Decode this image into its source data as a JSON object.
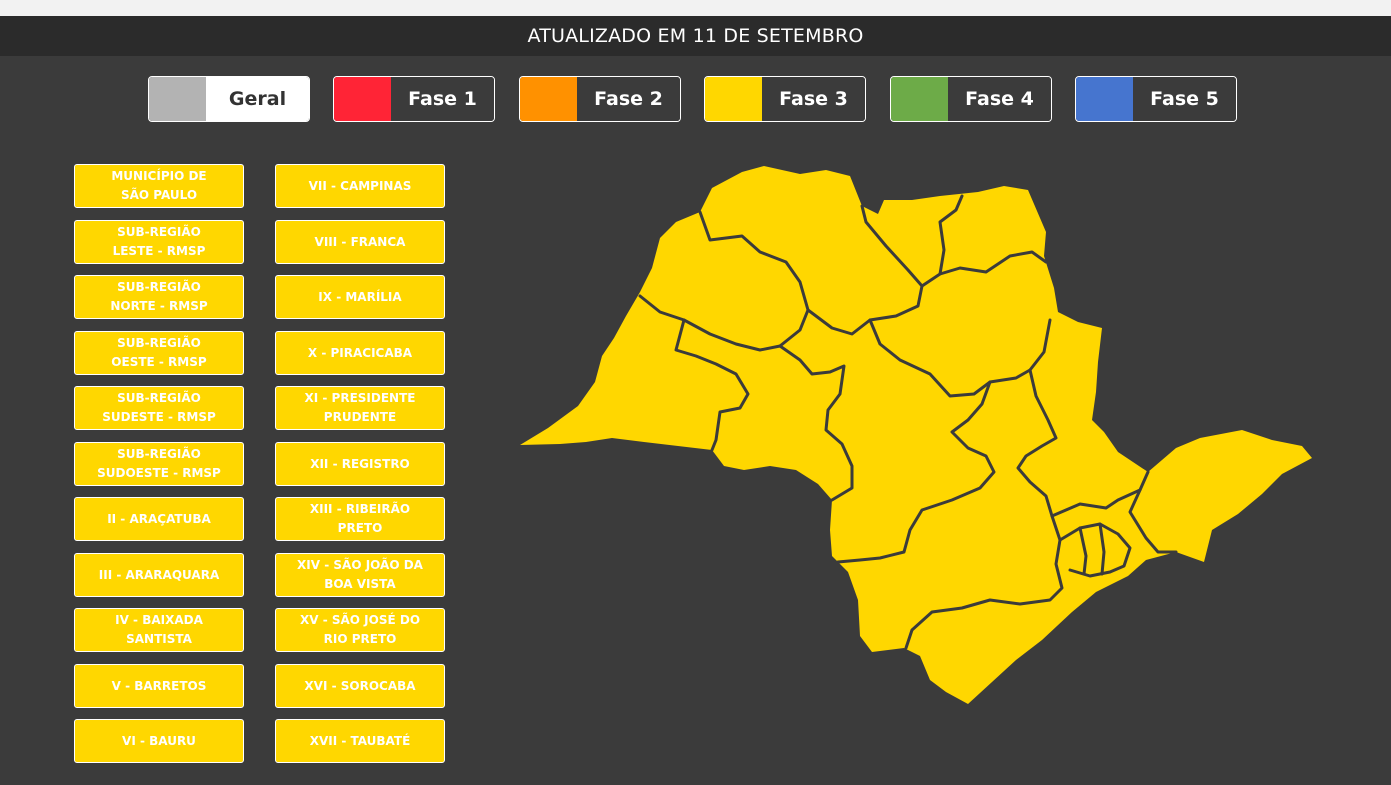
{
  "header": {
    "title": "ATUALIZADO EM 11 DE SETEMBRO"
  },
  "legend": [
    {
      "label": "Geral",
      "color": "#b3b3b3"
    },
    {
      "label": "Fase 1",
      "color": "#ff2436"
    },
    {
      "label": "Fase 2",
      "color": "#ff9100"
    },
    {
      "label": "Fase 3",
      "color": "#ffd700"
    },
    {
      "label": "Fase 4",
      "color": "#6dab48"
    },
    {
      "label": "Fase 5",
      "color": "#4675cf"
    }
  ],
  "regions_left": [
    {
      "label": "MUNICÍPIO DE\nSÃO PAULO"
    },
    {
      "label": "SUB-REGIÃO\nLESTE - RMSP"
    },
    {
      "label": "SUB-REGIÃO\nNORTE - RMSP"
    },
    {
      "label": "SUB-REGIÃO\nOESTE - RMSP"
    },
    {
      "label": "SUB-REGIÃO\nSUDESTE - RMSP"
    },
    {
      "label": "SUB-REGIÃO\nSUDOESTE - RMSP"
    },
    {
      "label": "II - ARAÇATUBA"
    },
    {
      "label": "III - ARARAQUARA"
    },
    {
      "label": "IV - BAIXADA\nSANTISTA"
    },
    {
      "label": "V - BARRETOS"
    },
    {
      "label": "VI - BAURU"
    }
  ],
  "regions_right": [
    {
      "label": "VII - CAMPINAS"
    },
    {
      "label": "VIII - FRANCA"
    },
    {
      "label": "IX - MARÍLIA"
    },
    {
      "label": "X - PIRACICABA"
    },
    {
      "label": "XI - PRESIDENTE\nPRUDENTE"
    },
    {
      "label": "XII - REGISTRO"
    },
    {
      "label": "XIII - RIBEIRÃO\nPRETO"
    },
    {
      "label": "XIV - SÃO JOÃO DA\nBOA VISTA"
    },
    {
      "label": "XV - SÃO JOSÉ DO\nRIO PRETO"
    },
    {
      "label": "XVI - SOROCABA"
    },
    {
      "label": "XVII - TAUBATÉ"
    }
  ],
  "map": {
    "fill_color": "#ffd700",
    "phase": "Fase 3"
  }
}
